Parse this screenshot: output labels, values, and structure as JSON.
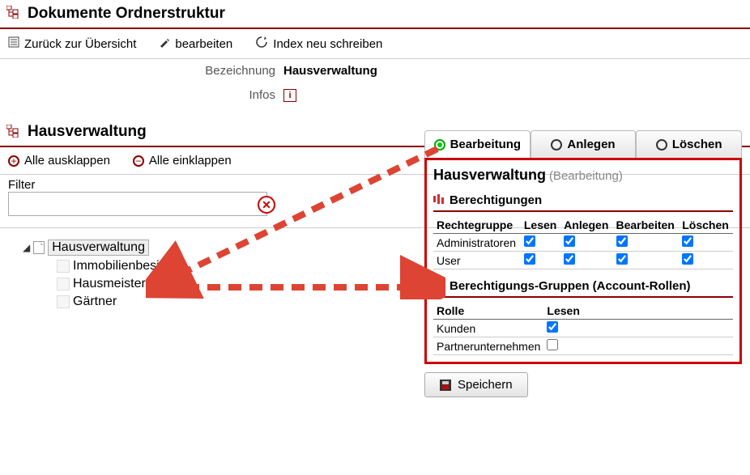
{
  "header": {
    "title": "Dokumente Ordnerstruktur"
  },
  "toolbar": {
    "back": "Zurück zur Übersicht",
    "edit": "bearbeiten",
    "reindex": "Index neu schreiben"
  },
  "form": {
    "label_bezeichnung": "Bezeichnung",
    "value_bezeichnung": "Hausverwaltung",
    "label_infos": "Infos",
    "infos_icon_char": "i"
  },
  "subheader": {
    "title": "Hausverwaltung"
  },
  "expand": {
    "all_expand": "Alle ausklappen",
    "all_collapse": "Alle einklappen"
  },
  "filter": {
    "label": "Filter",
    "value": ""
  },
  "tree": {
    "root": "Hausverwaltung",
    "children": [
      "Immobilienbesitzer",
      "Hausmeister",
      "Gärtner"
    ]
  },
  "tabs": {
    "bearbeitung": "Bearbeitung",
    "anlegen": "Anlegen",
    "loeschen": "Löschen"
  },
  "permissions": {
    "title": "Hausverwaltung",
    "title_suffix": "(Bearbeitung)",
    "section_berechtigungen": "Berechtigungen",
    "cols": {
      "rechtegruppe": "Rechtegruppe",
      "lesen": "Lesen",
      "anlegen": "Anlegen",
      "bearbeiten": "Bearbeiten",
      "loeschen": "Löschen"
    },
    "rows": [
      {
        "name": "Administratoren",
        "lesen": true,
        "anlegen": true,
        "bearbeiten": true,
        "loeschen": true
      },
      {
        "name": "User",
        "lesen": true,
        "anlegen": true,
        "bearbeiten": true,
        "loeschen": true
      }
    ],
    "section_gruppen": "Berechtigungs-Gruppen (Account-Rollen)",
    "role_cols": {
      "rolle": "Rolle",
      "lesen": "Lesen"
    },
    "role_rows": [
      {
        "name": "Kunden",
        "lesen": true
      },
      {
        "name": "Partnerunternehmen",
        "lesen": false
      }
    ]
  },
  "save": {
    "label": "Speichern"
  }
}
